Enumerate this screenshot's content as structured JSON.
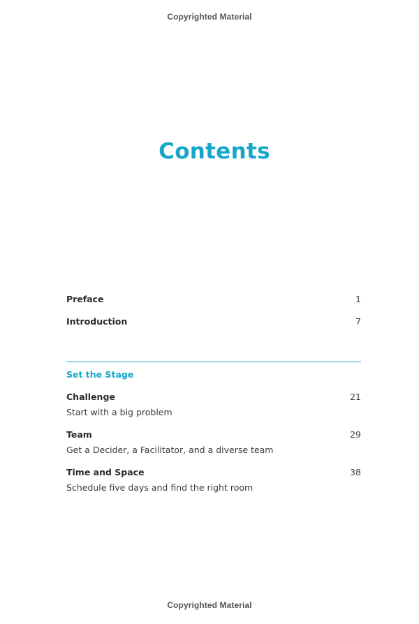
{
  "header": {
    "copyright": "Copyrighted Material"
  },
  "footer": {
    "copyright": "Copyrighted Material"
  },
  "title": "Contents",
  "front_matter": [
    {
      "title": "Preface",
      "page": "1"
    },
    {
      "title": "Introduction",
      "page": "7"
    }
  ],
  "section": {
    "title": "Set the Stage",
    "entries": [
      {
        "title": "Challenge",
        "page": "21",
        "subtitle": "Start with a big problem"
      },
      {
        "title": "Team",
        "page": "29",
        "subtitle": "Get a Decider, a Facilitator, and a diverse team"
      },
      {
        "title": "Time and Space",
        "page": "38",
        "subtitle": "Schedule five days and find the right room"
      }
    ]
  },
  "colors": {
    "accent": "#16a6c9",
    "text": "#2b2b2b"
  }
}
